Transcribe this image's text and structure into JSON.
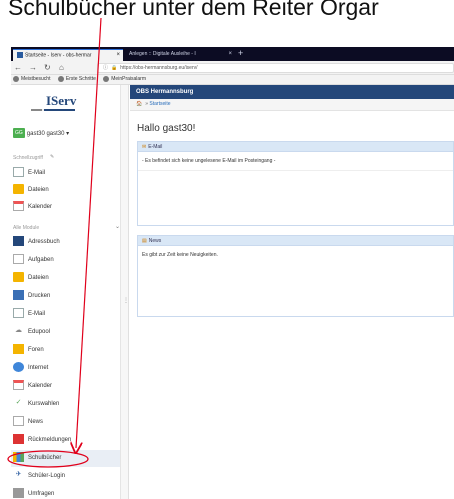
{
  "caption": {
    "text": "Schulbücher unter dem Reiter Orgar"
  },
  "browser": {
    "tabs": [
      {
        "label": "Startseite - Iserv - obs-hermar",
        "active": true
      },
      {
        "label": "Anlegen :: Digitale Ausleihe - I",
        "active": false
      }
    ],
    "new_tab": "+",
    "url": "https://obs-hermannsburg.eu/iserv/",
    "bookmarks": [
      "Meistbesucht",
      "Erste Schritte",
      "MeinPraisalarm"
    ],
    "colors": {
      "tabbar": "#0c0c23",
      "accent": "#24477a"
    }
  },
  "sidebar": {
    "logo": "IServ",
    "user_badge": "GG",
    "user_name": "gast30 gast30 ▾",
    "quick_access_label": "Schnellzugriff",
    "quick_items": [
      {
        "label": "E-Mail",
        "icon": "mail-icon"
      },
      {
        "label": "Dateien",
        "icon": "folder-icon"
      },
      {
        "label": "Kalender",
        "icon": "calendar-icon"
      }
    ],
    "modules_label": "Alle Module",
    "modules": [
      {
        "label": "Adressbuch",
        "icon": "address-book-icon"
      },
      {
        "label": "Aufgaben",
        "icon": "tasks-icon"
      },
      {
        "label": "Dateien",
        "icon": "folder-icon"
      },
      {
        "label": "Drucken",
        "icon": "printer-icon"
      },
      {
        "label": "E-Mail",
        "icon": "mail-icon"
      },
      {
        "label": "Edupool",
        "icon": "edupool-icon"
      },
      {
        "label": "Foren",
        "icon": "forum-icon"
      },
      {
        "label": "Internet",
        "icon": "globe-icon"
      },
      {
        "label": "Kalender",
        "icon": "calendar-icon"
      },
      {
        "label": "Kurswahlen",
        "icon": "check-icon"
      },
      {
        "label": "News",
        "icon": "news-icon"
      },
      {
        "label": "Rückmeldungen",
        "icon": "chart-icon"
      },
      {
        "label": "Schulbücher",
        "icon": "books-icon"
      },
      {
        "label": "Schüler-Login",
        "icon": "login-icon"
      },
      {
        "label": "Umfragen",
        "icon": "survey-icon"
      }
    ]
  },
  "main": {
    "header": "OBS Hermannsburg",
    "breadcrumb": "Startseite",
    "greeting": "Hallo gast30!",
    "email_panel": {
      "title": "E-Mail",
      "message": "- Es befindet sich keine ungelesene E-Mail im Posteingang -"
    },
    "news_panel": {
      "title": "News",
      "message": "Es gibt zur Zeit keine Neuigkeiten."
    }
  },
  "annotation": {
    "color": "#e0001b",
    "target": "Schulbücher"
  }
}
